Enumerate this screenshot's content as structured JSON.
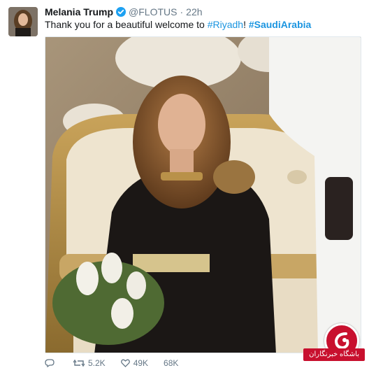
{
  "tweet": {
    "author_name": "Melania Trump",
    "handle": "@FLOTUS",
    "separator": "·",
    "time": "22h",
    "text_prefix": "Thank you for a beautiful welcome to ",
    "hashtag_1": "#Riyadh",
    "text_mid": "! ",
    "hashtag_2": "#SaudiArabia"
  },
  "actions": {
    "reply_count": "",
    "retweet_count": "5.2K",
    "like_count": "49K",
    "extra_count": "68K"
  },
  "watermark": {
    "text": "باشگاه خبرنگاران"
  },
  "colors": {
    "link": "#1b95e0",
    "verified": "#1da1f2",
    "meta_gray": "#657786",
    "watermark_red": "#c8102e"
  }
}
